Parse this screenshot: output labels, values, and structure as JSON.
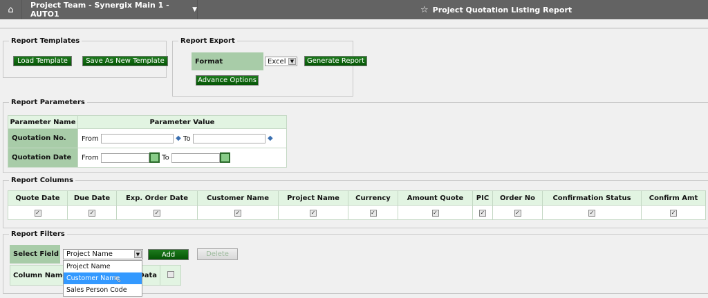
{
  "header": {
    "home_icon": "home-icon",
    "project": "Project Team - Synergix Main 1 - AUTO1",
    "report_title": "Project Quotation Listing Report"
  },
  "templates": {
    "legend": "Report Templates",
    "load": "Load Template",
    "save_new": "Save As New Template"
  },
  "export": {
    "legend": "Report Export",
    "format_label": "Format",
    "format_value": "Excel",
    "generate": "Generate Report",
    "advance": "Advance Options"
  },
  "parameters": {
    "legend": "Report Parameters",
    "col_name": "Parameter Name",
    "col_value": "Parameter Value",
    "rows": [
      {
        "name": "Quotation No.",
        "from": "From",
        "to": "To",
        "icon": "lookup-icon"
      },
      {
        "name": "Quotation Date",
        "from": "From",
        "to": "To",
        "icon": "calendar-icon"
      }
    ]
  },
  "columns": {
    "legend": "Report Columns",
    "headers": [
      "Quote Date",
      "Due Date",
      "Exp. Order Date",
      "Customer Name",
      "Project Name",
      "Currency",
      "Amount Quote",
      "PIC",
      "Order No",
      "Confirmation Status",
      "Confirm Amt"
    ],
    "checked": [
      true,
      true,
      true,
      true,
      true,
      true,
      true,
      true,
      true,
      true,
      true
    ]
  },
  "filters": {
    "legend": "Report Filters",
    "select_label": "Select Field",
    "select_value": "Project Name",
    "add": "Add",
    "delete": "Delete",
    "col_name": "Column Name",
    "data_label": "Data",
    "options": [
      "Project Name",
      "Customer Name",
      "Sales Person Code"
    ],
    "highlighted": "Customer Name"
  },
  "colors": {
    "topbar": "#636363",
    "button_green": "#0b600b",
    "label_green": "#a8cca8",
    "header_green": "#e2f4e2",
    "highlight": "#3399ff"
  }
}
